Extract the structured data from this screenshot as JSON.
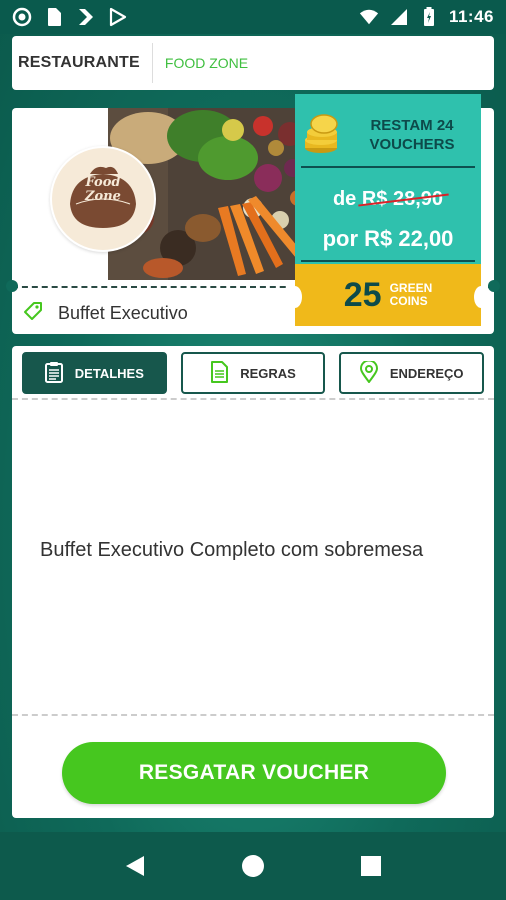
{
  "status_bar": {
    "time": "11:46"
  },
  "header": {
    "label": "RESTAURANTE",
    "value": "FOOD ZONE"
  },
  "offer": {
    "logo_text_line1": "Food",
    "logo_text_line2": "Zone",
    "vouchers_left": "RESTAM 24 VOUCHERS",
    "old_prefix": "de",
    "old_price": "R$ 28,90",
    "new_price": "por R$ 22,00",
    "coins_number": "25",
    "coins_label_line1": "GREEN",
    "coins_label_line2": "COINS",
    "offer_name": "Buffet Executivo"
  },
  "tabs": [
    {
      "label": "DETALHES",
      "icon": "clipboard-icon",
      "active": true
    },
    {
      "label": "REGRAS",
      "icon": "document-icon",
      "active": false
    },
    {
      "label": "ENDEREÇO",
      "icon": "location-pin-icon",
      "active": false
    }
  ],
  "details": {
    "description": "Buffet Executivo Completo com sobremesa"
  },
  "cta": {
    "label": "RESGATAR VOUCHER"
  },
  "colors": {
    "primary": "#17574c",
    "accent_teal": "#2fc1ad",
    "accent_yellow": "#f0b91a",
    "cta_green": "#46c71f",
    "strike_red": "#d9232a"
  }
}
